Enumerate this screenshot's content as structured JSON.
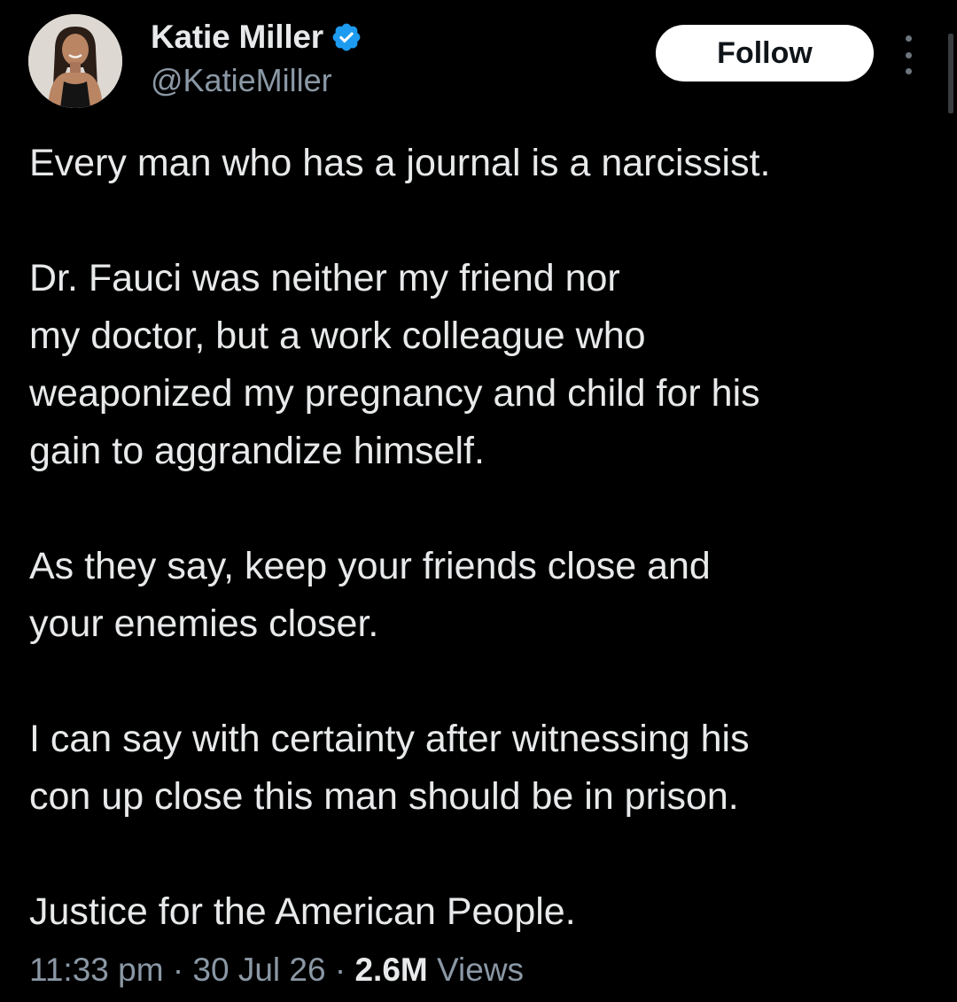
{
  "author": {
    "display_name": "Katie Miller",
    "handle": "@KatieMiller",
    "verified": true,
    "verified_color": "#1d9bf0"
  },
  "actions": {
    "follow_label": "Follow"
  },
  "icons": {
    "verified": "verified-badge-icon",
    "more": "more-options-icon"
  },
  "tweet": {
    "paragraphs": [
      "Every man who has a journal is a narcissist.",
      "Dr. Fauci was neither my friend nor\nmy doctor, but a work colleague who\nweaponized my pregnancy and child for his\ngain to aggrandize himself.",
      "As they say, keep your friends close and\nyour enemies closer.",
      "I can say with certainty after witnessing his\ncon up close this man should be in prison.",
      "Justice for the American People."
    ],
    "time": "11:33 pm",
    "separator": "·",
    "date": "30 Jul 26",
    "views_count": "2.6M",
    "views_label": "Views"
  },
  "colors": {
    "background": "#000000",
    "text_primary": "#e7e9ea",
    "text_secondary": "#8b98a5",
    "button_bg": "#ffffff",
    "button_text": "#0f1419"
  }
}
